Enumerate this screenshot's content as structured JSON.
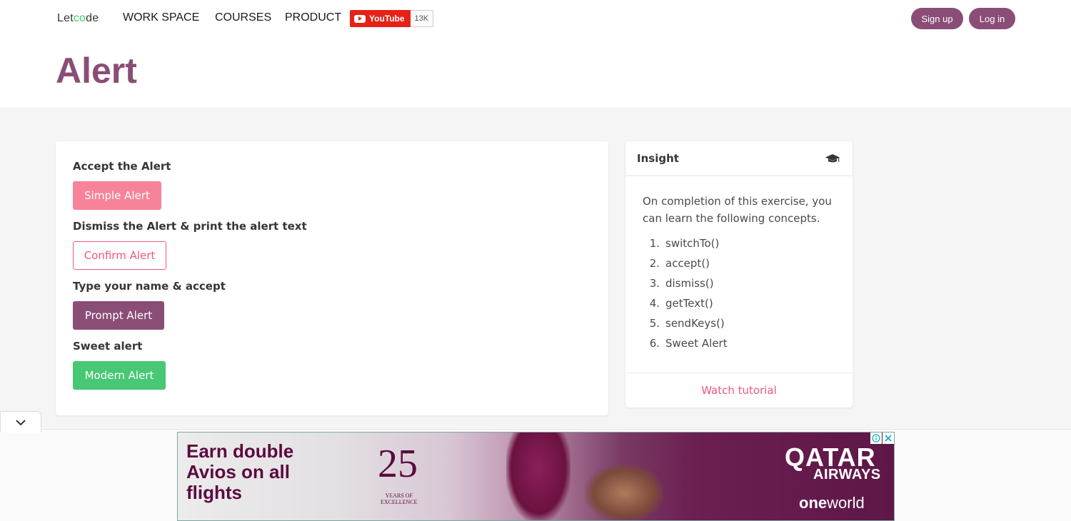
{
  "navbar": {
    "logo": {
      "pre": "Let",
      "mid": "co",
      "post": "de"
    },
    "links": [
      "WORK SPACE",
      "COURSES",
      "PRODUCT"
    ],
    "youtube": {
      "label": "YouTube",
      "count": "13K"
    },
    "signup_label": "Sign up",
    "login_label": "Log in"
  },
  "hero": {
    "title": "Alert"
  },
  "alerts": {
    "simple": {
      "label": "Accept the Alert",
      "button": "Simple Alert"
    },
    "confirm": {
      "label": "Dismiss the Alert & print the alert text",
      "button": "Confirm Alert"
    },
    "prompt": {
      "label": "Type your name & accept",
      "button": "Prompt Alert"
    },
    "modern": {
      "label": "Sweet alert",
      "button": "Modern Alert"
    }
  },
  "insight": {
    "title": "Insight",
    "icon": "graduation-cap-icon",
    "description": "On completion of this exercise, you can learn the following concepts.",
    "concepts": [
      {
        "num": "1.",
        "text": "switchTo()"
      },
      {
        "num": "2.",
        "text": "accept()"
      },
      {
        "num": "3.",
        "text": "dismiss()"
      },
      {
        "num": "4.",
        "text": "getText()"
      },
      {
        "num": "5.",
        "text": "sendKeys()"
      },
      {
        "num": "6.",
        "text": "Sweet Alert"
      }
    ],
    "footer_link": "Watch tutorial"
  },
  "ad": {
    "headline": [
      "Earn double",
      "Avios on all",
      "flights"
    ],
    "anniversary": "25",
    "anniversary_sub": [
      "YEARS OF",
      "EXCELLENCE"
    ],
    "brand_line1": "QATAR",
    "brand_line2": "AIRWAYS",
    "brand_line3_bold": "one",
    "brand_line3_rest": "world"
  },
  "colors": {
    "brand": "#8a4d76",
    "simple_button": "#f78399",
    "confirm_button_border": "#f1577a",
    "modern_button": "#48c774",
    "youtube_red": "#e62117"
  }
}
